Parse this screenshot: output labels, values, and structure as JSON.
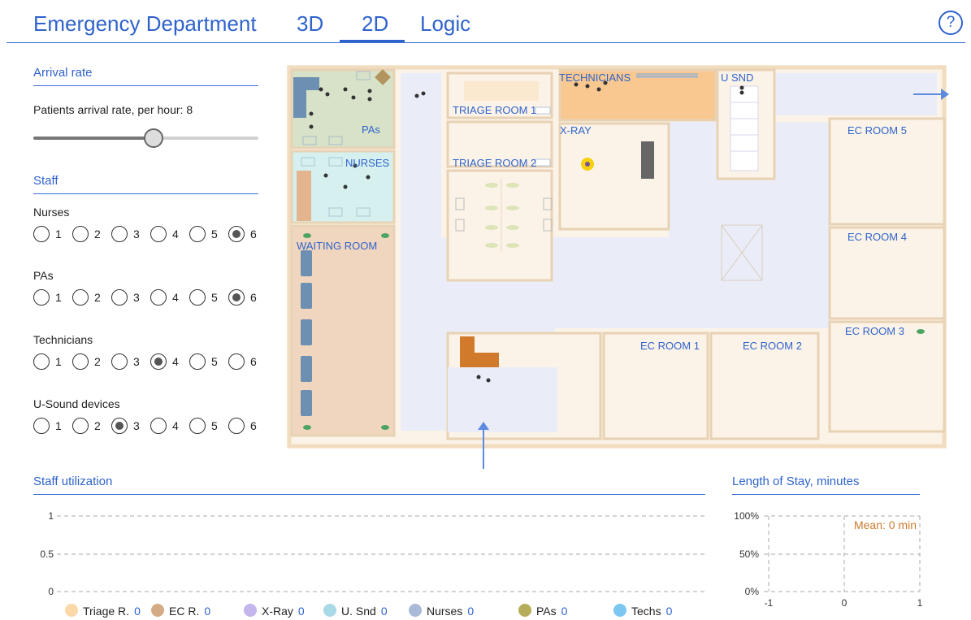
{
  "header": {
    "title": "Emergency Department",
    "tabs": [
      "3D",
      "2D",
      "Logic"
    ],
    "active_tab": "2D",
    "help_label": "?"
  },
  "arrival": {
    "section_title": "Arrival rate",
    "label": "Patients arrival rate, per hour:",
    "value": "8",
    "slider_fraction": 0.53
  },
  "staff": {
    "section_title": "Staff",
    "groups": [
      {
        "label": "Nurses",
        "options": [
          "1",
          "2",
          "3",
          "4",
          "5",
          "6"
        ],
        "selected": "6"
      },
      {
        "label": "PAs",
        "options": [
          "1",
          "2",
          "3",
          "4",
          "5",
          "6"
        ],
        "selected": "6"
      },
      {
        "label": "Technicians",
        "options": [
          "1",
          "2",
          "3",
          "4",
          "5",
          "6"
        ],
        "selected": "4"
      },
      {
        "label": "U-Sound devices",
        "options": [
          "1",
          "2",
          "3",
          "4",
          "5",
          "6"
        ],
        "selected": "3"
      }
    ]
  },
  "map": {
    "rooms": {
      "technicians": "TECHNICIANS",
      "usnd": "U SND",
      "pas": "PAs",
      "triage1": "TRIAGE ROOM 1",
      "triage2": "TRIAGE ROOM 2",
      "xray": "X-RAY",
      "nurses": "NURSES",
      "waiting": "WAITING ROOM",
      "ec5": "EC ROOM 5",
      "ec4": "EC ROOM 4",
      "ec3": "EC ROOM 3",
      "ec2": "EC ROOM 2",
      "ec1": "EC ROOM 1"
    }
  },
  "utilization": {
    "title": "Staff utilization",
    "y_ticks": [
      "1",
      "0.5",
      "0"
    ]
  },
  "los": {
    "title": "Length of Stay, minutes",
    "y_ticks": [
      "100%",
      "50%",
      "0%"
    ],
    "x_ticks": [
      "-1",
      "0",
      "1"
    ],
    "mean_label": "Mean: 0 min"
  },
  "legend": [
    {
      "name": "Triage R.",
      "value": "0",
      "color": "#fbd8a8"
    },
    {
      "name": "EC R.",
      "value": "0",
      "color": "#d4ab85"
    },
    {
      "name": "X-Ray",
      "value": "0",
      "color": "#c4b5ec"
    },
    {
      "name": "U. Snd",
      "value": "0",
      "color": "#a8d9e6"
    },
    {
      "name": "Nurses",
      "value": "0",
      "color": "#a9b9d8"
    },
    {
      "name": "PAs",
      "value": "0",
      "color": "#b6ad5a"
    },
    {
      "name": "Techs",
      "value": "0",
      "color": "#7cc6f2"
    }
  ],
  "chart_data": [
    {
      "type": "bar",
      "title": "Staff utilization",
      "categories": [
        "Triage R.",
        "EC R.",
        "X-Ray",
        "U. Snd",
        "Nurses",
        "PAs",
        "Techs"
      ],
      "values": [
        0,
        0,
        0,
        0,
        0,
        0,
        0
      ],
      "ylim": [
        0,
        1
      ],
      "y_ticks": [
        0,
        0.5,
        1
      ],
      "grid": true
    },
    {
      "type": "bar",
      "title": "Length of Stay, minutes",
      "xlim": [
        -1,
        1
      ],
      "x_ticks": [
        -1,
        0,
        1
      ],
      "y_ticks": [
        "0%",
        "50%",
        "100%"
      ],
      "values": [],
      "annotation": "Mean: 0 min",
      "grid": true
    }
  ]
}
